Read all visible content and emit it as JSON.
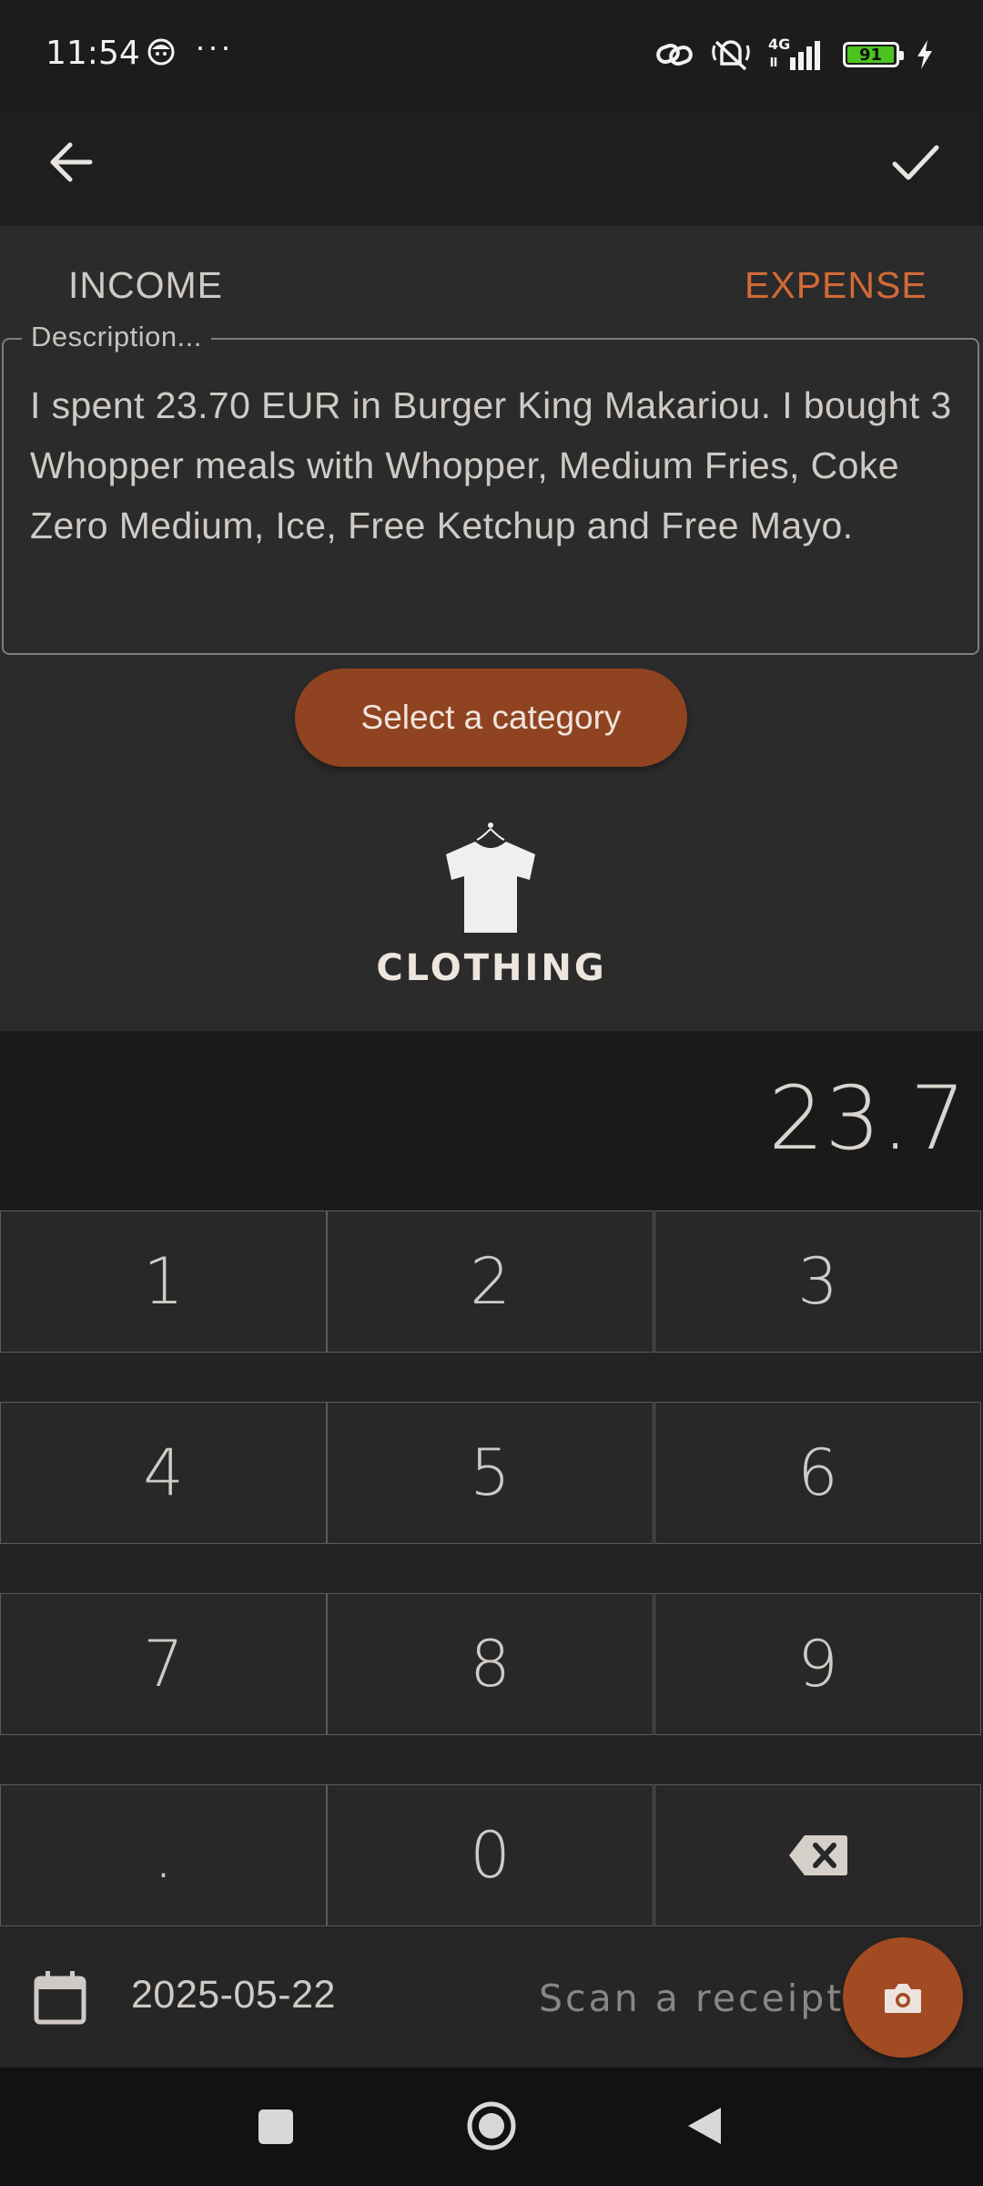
{
  "status_bar": {
    "time": "11:54",
    "more": "···",
    "network": "4G",
    "battery_level": "91"
  },
  "app_bar": {
    "back_icon": "arrow-back-icon",
    "confirm_icon": "check-icon"
  },
  "transaction_type": {
    "income_label": "INCOME",
    "expense_label": "EXPENSE",
    "selected": "expense"
  },
  "description": {
    "label": "Description...",
    "value": "I spent 23.70 EUR in Burger King Makariou. I bought 3 Whopper meals with Whopper, Medium Fries, Coke Zero Medium, Ice, Free Ketchup and Free Mayo."
  },
  "category": {
    "button_label": "Select a category",
    "selected_label": "CLOTHING",
    "selected_icon": "tshirt-icon"
  },
  "amount": {
    "value": "23.7"
  },
  "keypad": {
    "keys": [
      "1",
      "2",
      "3",
      "4",
      "5",
      "6",
      "7",
      "8",
      "9",
      ".",
      "0",
      "backspace"
    ]
  },
  "bottom_bar": {
    "date": "2025-05-22",
    "scan_label": "Scan a receipt",
    "calendar_icon": "calendar-icon",
    "camera_icon": "camera-icon"
  },
  "colors": {
    "accent": "#d26a38",
    "button_bg": "#8f4320",
    "fab_bg": "#a24a22",
    "background": "#2b2b2b"
  }
}
